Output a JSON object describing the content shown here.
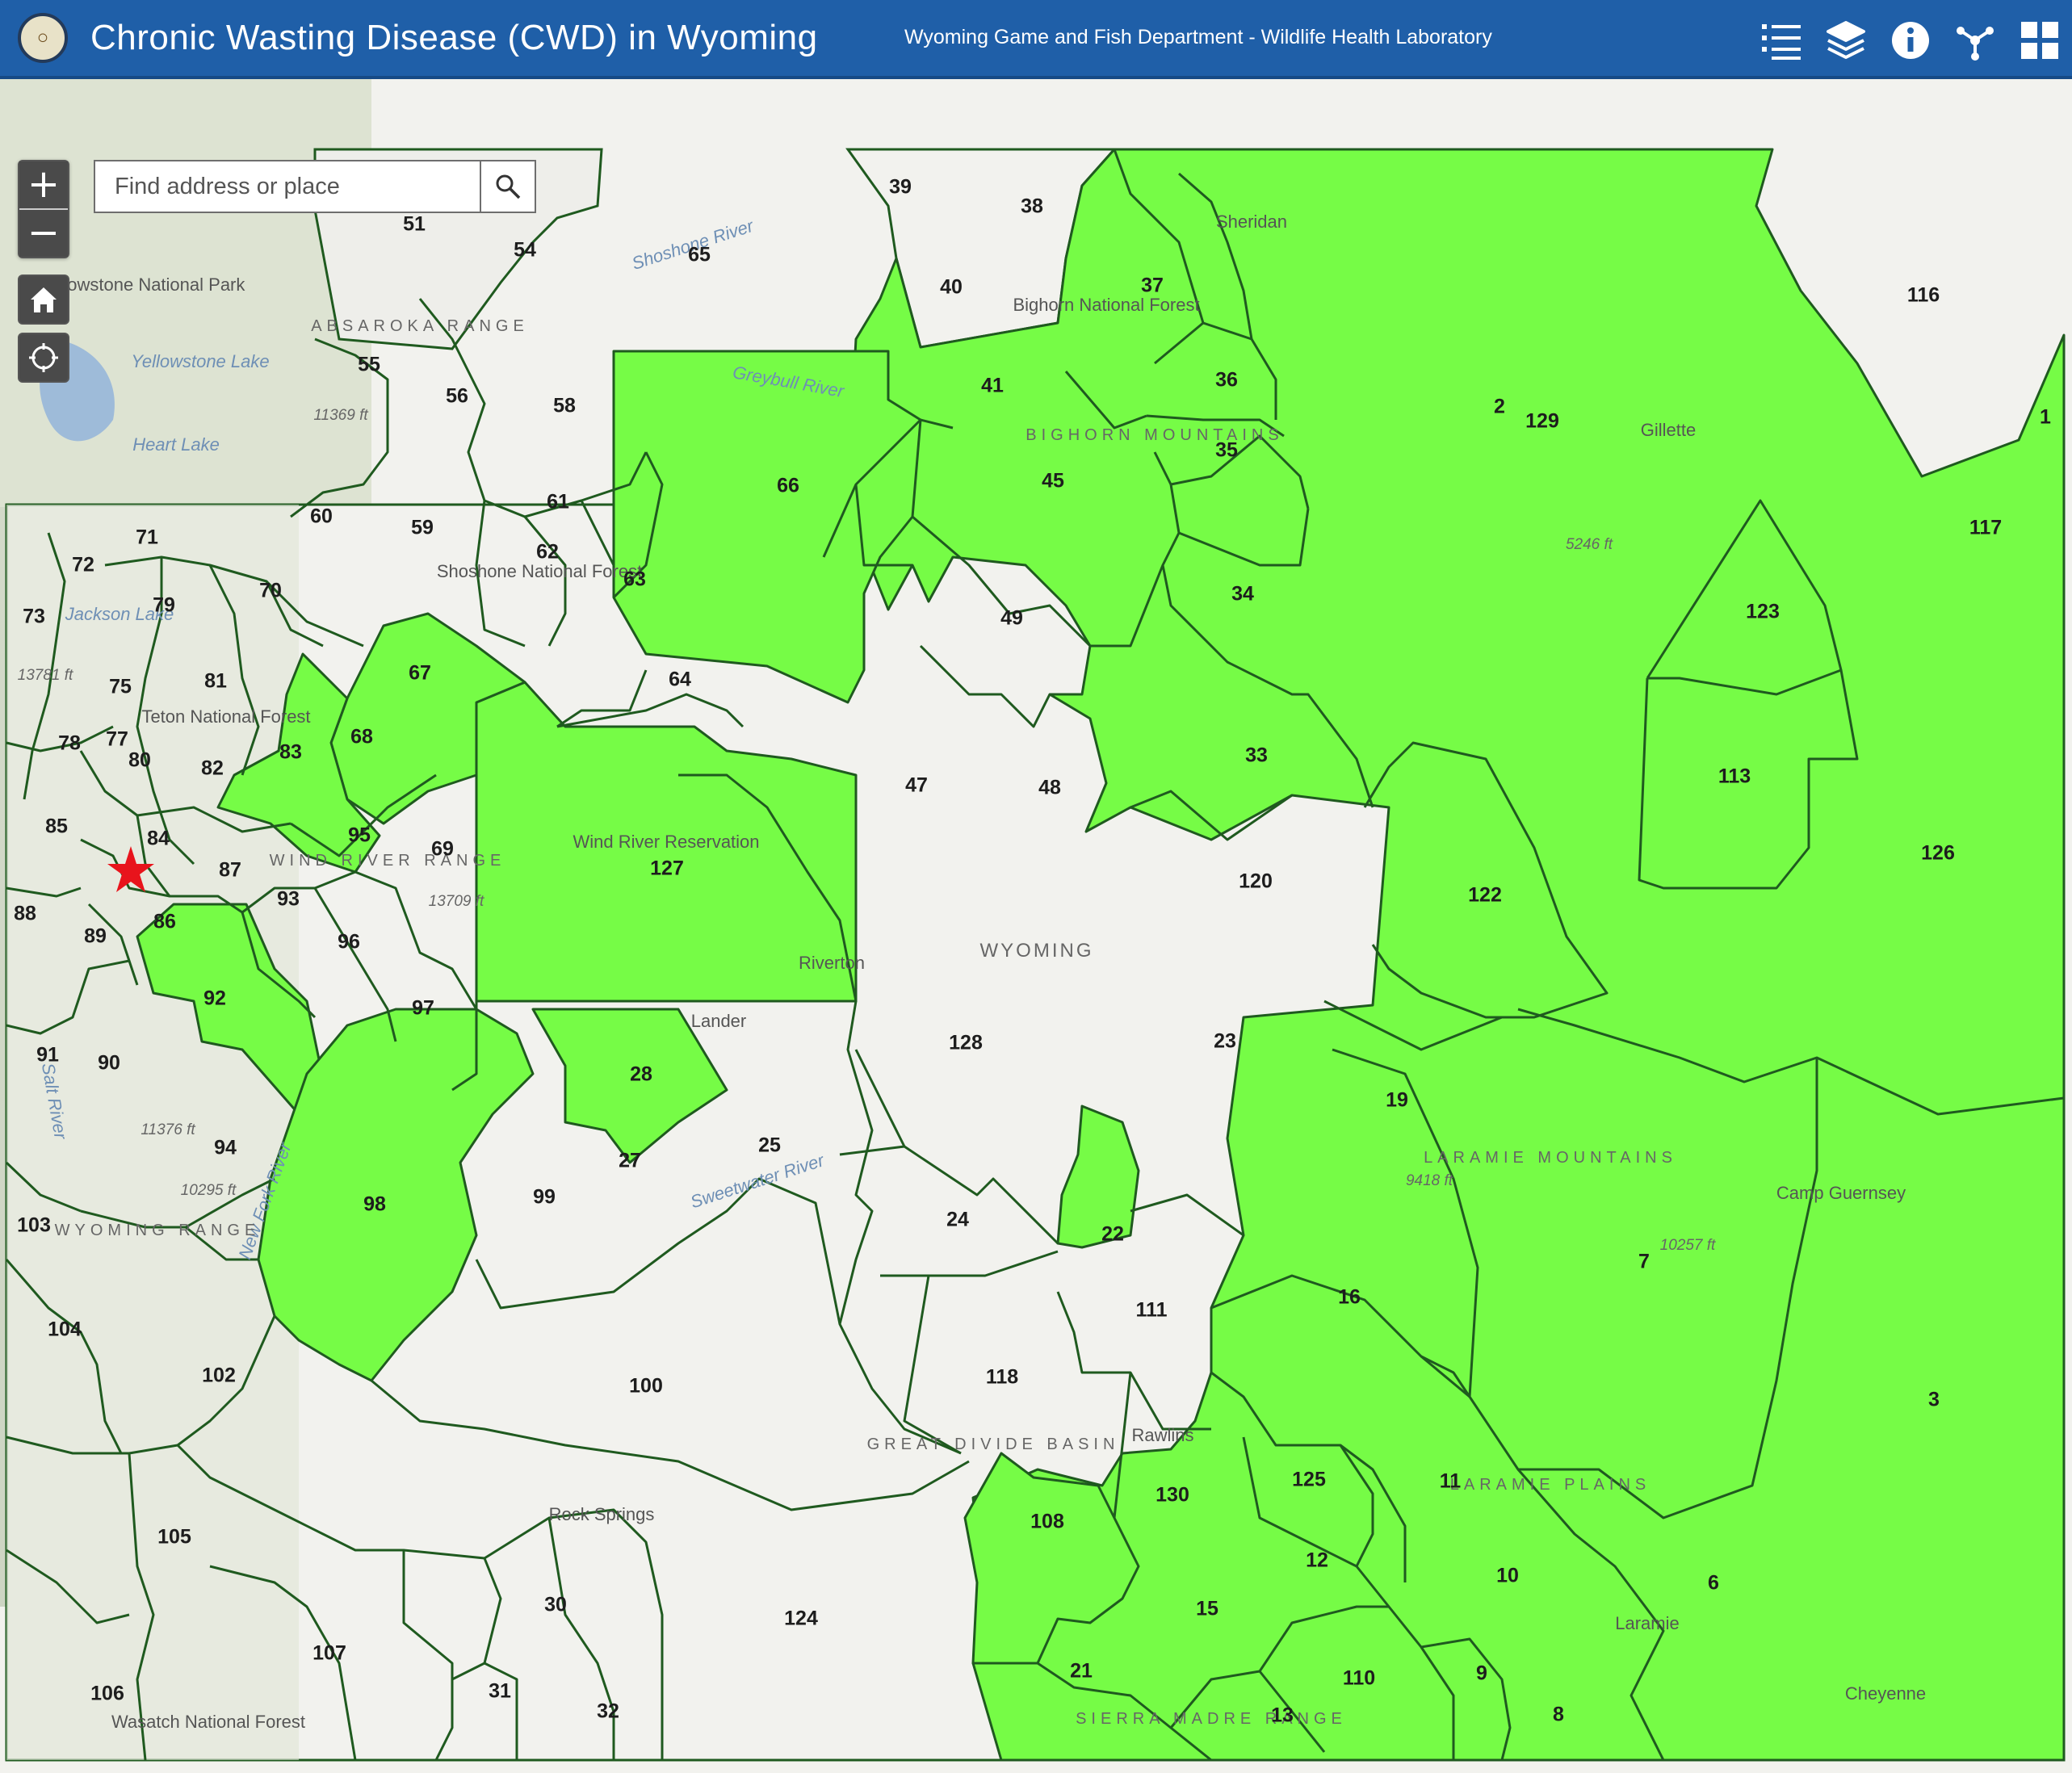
{
  "header": {
    "title": "Chronic Wasting Disease (CWD) in Wyoming",
    "subtitle": "Wyoming Game and Fish Department - Wildlife Health Laboratory",
    "tools": [
      "legend-icon",
      "layers-icon",
      "info-icon",
      "share-icon",
      "grid-icon"
    ]
  },
  "search": {
    "placeholder": "Find address or place"
  },
  "controls": {
    "zoom_in": "+",
    "zoom_out": "−"
  },
  "colors": {
    "header": "#1f5fa8",
    "positive_area": "#76fc46",
    "boundary": "#1f5a1f",
    "marker": "#e8141c"
  },
  "map": {
    "state_label": "WYOMING",
    "marker": {
      "type": "star",
      "meaning": "red star marker"
    },
    "areas": [
      {
        "label": "1",
        "positive": true
      },
      {
        "label": "2",
        "positive": false
      },
      {
        "label": "3",
        "positive": true
      },
      {
        "label": "6",
        "positive": true
      },
      {
        "label": "7",
        "positive": true
      },
      {
        "label": "8",
        "positive": true
      },
      {
        "label": "9",
        "positive": true
      },
      {
        "label": "10",
        "positive": true
      },
      {
        "label": "11",
        "positive": true
      },
      {
        "label": "12",
        "positive": true
      },
      {
        "label": "13",
        "positive": true
      },
      {
        "label": "15",
        "positive": false
      },
      {
        "label": "16",
        "positive": true
      },
      {
        "label": "19",
        "positive": true
      },
      {
        "label": "21",
        "positive": true
      },
      {
        "label": "22",
        "positive": true
      },
      {
        "label": "23",
        "positive": true
      },
      {
        "label": "24",
        "positive": false
      },
      {
        "label": "25",
        "positive": false
      },
      {
        "label": "27",
        "positive": false
      },
      {
        "label": "28",
        "positive": true
      },
      {
        "label": "30",
        "positive": false
      },
      {
        "label": "31",
        "positive": false
      },
      {
        "label": "32",
        "positive": false
      },
      {
        "label": "33",
        "positive": true
      },
      {
        "label": "34",
        "positive": true
      },
      {
        "label": "35",
        "positive": true
      },
      {
        "label": "36",
        "positive": true
      },
      {
        "label": "37",
        "positive": true
      },
      {
        "label": "38",
        "positive": false
      },
      {
        "label": "39",
        "positive": false
      },
      {
        "label": "40",
        "positive": false
      },
      {
        "label": "41",
        "positive": true
      },
      {
        "label": "45",
        "positive": true
      },
      {
        "label": "47",
        "positive": true
      },
      {
        "label": "48",
        "positive": true
      },
      {
        "label": "49",
        "positive": true
      },
      {
        "label": "51",
        "positive": false
      },
      {
        "label": "54",
        "positive": false
      },
      {
        "label": "55",
        "positive": false
      },
      {
        "label": "56",
        "positive": false
      },
      {
        "label": "58",
        "positive": true
      },
      {
        "label": "59",
        "positive": true
      },
      {
        "label": "60",
        "positive": false
      },
      {
        "label": "61",
        "positive": false
      },
      {
        "label": "62",
        "positive": false
      },
      {
        "label": "63",
        "positive": false
      },
      {
        "label": "64",
        "positive": false
      },
      {
        "label": "65",
        "positive": false
      },
      {
        "label": "66",
        "positive": true
      },
      {
        "label": "67",
        "positive": true
      },
      {
        "label": "68",
        "positive": false
      },
      {
        "label": "69",
        "positive": false
      },
      {
        "label": "70",
        "positive": false
      },
      {
        "label": "71",
        "positive": false
      },
      {
        "label": "72",
        "positive": false
      },
      {
        "label": "73",
        "positive": false
      },
      {
        "label": "75",
        "positive": false
      },
      {
        "label": "77",
        "positive": false
      },
      {
        "label": "78",
        "positive": false
      },
      {
        "label": "79",
        "positive": false
      },
      {
        "label": "80",
        "positive": false
      },
      {
        "label": "81",
        "positive": false
      },
      {
        "label": "82",
        "positive": false
      },
      {
        "label": "83",
        "positive": false
      },
      {
        "label": "84",
        "positive": false
      },
      {
        "label": "85",
        "positive": false
      },
      {
        "label": "86",
        "positive": false
      },
      {
        "label": "87",
        "positive": false
      },
      {
        "label": "88",
        "positive": false
      },
      {
        "label": "89",
        "positive": false
      },
      {
        "label": "90",
        "positive": false
      },
      {
        "label": "91",
        "positive": false
      },
      {
        "label": "92",
        "positive": true
      },
      {
        "label": "93",
        "positive": false
      },
      {
        "label": "94",
        "positive": false
      },
      {
        "label": "95",
        "positive": false
      },
      {
        "label": "96",
        "positive": false
      },
      {
        "label": "97",
        "positive": false
      },
      {
        "label": "98",
        "positive": true
      },
      {
        "label": "99",
        "positive": false
      },
      {
        "label": "100",
        "positive": false
      },
      {
        "label": "102",
        "positive": false
      },
      {
        "label": "103",
        "positive": false
      },
      {
        "label": "104",
        "positive": false
      },
      {
        "label": "105",
        "positive": false
      },
      {
        "label": "106",
        "positive": false
      },
      {
        "label": "107",
        "positive": false
      },
      {
        "label": "108",
        "positive": true
      },
      {
        "label": "110",
        "positive": true
      },
      {
        "label": "111",
        "positive": false
      },
      {
        "label": "113",
        "positive": true
      },
      {
        "label": "116",
        "positive": false
      },
      {
        "label": "117",
        "positive": true
      },
      {
        "label": "118",
        "positive": false
      },
      {
        "label": "120",
        "positive": false
      },
      {
        "label": "122",
        "positive": true
      },
      {
        "label": "123",
        "positive": true
      },
      {
        "label": "124",
        "positive": false
      },
      {
        "label": "125",
        "positive": true
      },
      {
        "label": "126",
        "positive": true
      },
      {
        "label": "127",
        "positive": true
      },
      {
        "label": "128",
        "positive": false
      },
      {
        "label": "129",
        "positive": false
      },
      {
        "label": "130",
        "positive": false
      }
    ],
    "place_labels": [
      "Sheridan",
      "Gillette",
      "Riverton",
      "Lander",
      "Rawlins",
      "Rock Springs",
      "Laramie",
      "Cheyenne",
      "Yellowstone National Park",
      "Shoshone National Forest",
      "Teton National Forest",
      "Bighorn National Forest",
      "Wind River Reservation",
      "Wasatch National Forest",
      "Camp Guernsey"
    ],
    "water_labels": [
      "Yellowstone Lake",
      "Heart Lake",
      "Jackson Lake",
      "Shoshone River",
      "Sweetwater River",
      "Greybull River",
      "New Fork River",
      "Salt River"
    ],
    "terrain_labels": [
      "ABSAROKA RANGE",
      "BIGHORN MOUNTAINS",
      "WIND RIVER RANGE",
      "WYOMING RANGE",
      "GREAT DIVIDE BASIN",
      "LARAMIE MOUNTAINS",
      "LARAMIE PLAINS",
      "SIERRA MADRE RANGE"
    ],
    "elevation_labels": [
      "11369 ft",
      "13781 ft",
      "11376 ft",
      "10295 ft",
      "13709 ft",
      "9418 ft",
      "10257 ft",
      "5246 ft"
    ]
  }
}
